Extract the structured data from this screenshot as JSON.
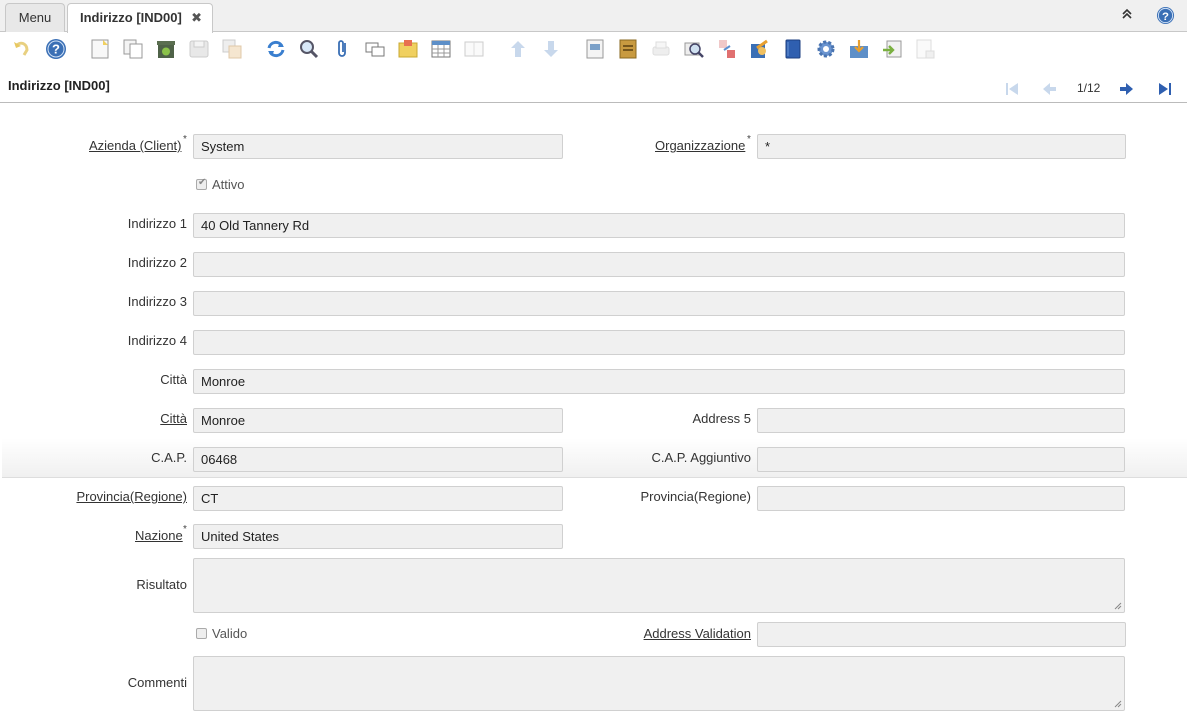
{
  "tabs": {
    "menu_label": "Menu",
    "active_label": "Indirizzo [IND00]",
    "close_glyph": "✖"
  },
  "toolbar": {
    "icons": [
      "undo-icon",
      "help-icon",
      "new-icon",
      "copy-icon",
      "delete-icon",
      "save-icon",
      "save-new-icon",
      "refresh-icon",
      "find-icon",
      "attachment-icon",
      "chat-icon",
      "notes-icon",
      "grid-toggle-icon",
      "multi-grid-icon",
      "previous-record-icon",
      "next-record-icon",
      "report-icon",
      "archive-icon",
      "print-icon",
      "zoom-across-icon",
      "related-info-icon",
      "workflow-icon",
      "product-info-icon",
      "process-icon",
      "export-icon",
      "import-icon",
      "print-preview-icon"
    ]
  },
  "header": {
    "title": "Indirizzo [IND00]",
    "pager": "1/12"
  },
  "form": {
    "client": {
      "label": "Azienda (Client)",
      "value": "System"
    },
    "org": {
      "label": "Organizzazione",
      "value": "*"
    },
    "active": {
      "label": "Attivo",
      "checked": true
    },
    "address1": {
      "label": "Indirizzo 1",
      "value": "40 Old Tannery Rd"
    },
    "address2": {
      "label": "Indirizzo 2",
      "value": ""
    },
    "address3": {
      "label": "Indirizzo 3",
      "value": ""
    },
    "address4": {
      "label": "Indirizzo 4",
      "value": ""
    },
    "city_text": {
      "label": "Città",
      "value": "Monroe"
    },
    "city": {
      "label": "Città",
      "value": "Monroe"
    },
    "address5": {
      "label": "Address 5",
      "value": ""
    },
    "zip": {
      "label": "C.A.P.",
      "value": "06468"
    },
    "zip_add": {
      "label": "C.A.P. Aggiuntivo",
      "value": ""
    },
    "region": {
      "label": "Provincia(Regione)",
      "value": "CT"
    },
    "region_text": {
      "label": "Provincia(Regione)",
      "value": ""
    },
    "country": {
      "label": "Nazione",
      "value": "United States"
    },
    "result": {
      "label": "Risultato",
      "value": ""
    },
    "valid": {
      "label": "Valido",
      "checked": false
    },
    "addr_validation": {
      "label": "Address Validation",
      "value": ""
    },
    "comments": {
      "label": "Commenti",
      "value": ""
    },
    "required_marker": "*"
  }
}
